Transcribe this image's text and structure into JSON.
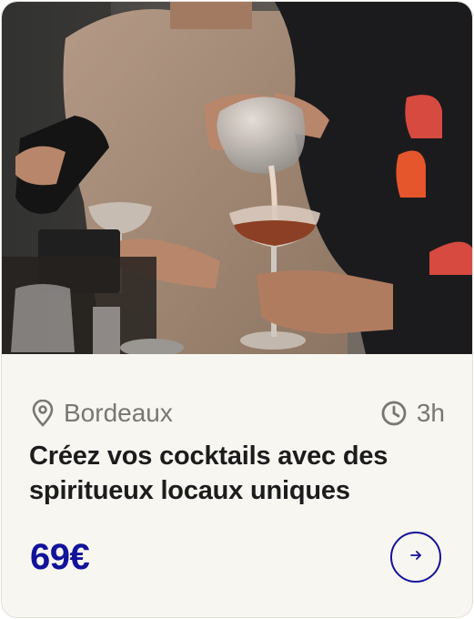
{
  "card": {
    "image_alt": "Deux personnes préparant des cocktails",
    "location": "Bordeaux",
    "location_icon": "map-pin-icon",
    "duration": "3h",
    "duration_icon": "clock-icon",
    "title": "Créez vos cocktails avec des spiritueux locaux uniques",
    "price": "69€",
    "action_icon": "arrow-right-icon"
  },
  "colors": {
    "accent": "#12139a",
    "card_background": "#f8f6f1",
    "meta_text": "#7a7772",
    "title_text": "#1c1c1c"
  }
}
